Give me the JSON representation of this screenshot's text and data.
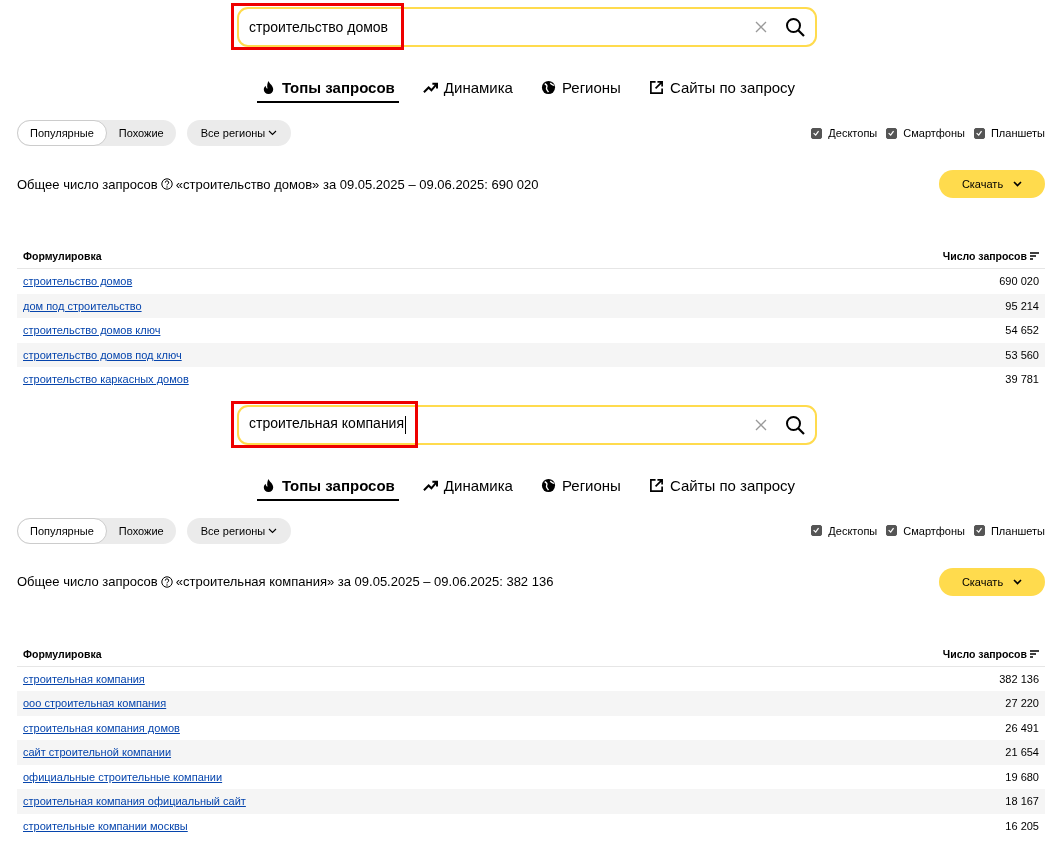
{
  "panels": [
    {
      "search": {
        "value": "строительство домов",
        "highlighted": true,
        "focused": false
      },
      "tabs": [
        {
          "label": "Топы запросов",
          "kind": "fire",
          "selected": true
        },
        {
          "label": "Динамика",
          "kind": "trend",
          "selected": false
        },
        {
          "label": "Регионы",
          "kind": "globe",
          "selected": false
        },
        {
          "label": "Сайты по запросу",
          "kind": "external",
          "selected": false
        }
      ],
      "modes": [
        {
          "label": "Популярные",
          "selected": true
        },
        {
          "label": "Похожие",
          "selected": false
        }
      ],
      "region_button": "Все регионы",
      "devices": [
        {
          "label": "Десктопы",
          "checked": true
        },
        {
          "label": "Смартфоны",
          "checked": true
        },
        {
          "label": "Планшеты",
          "checked": true
        }
      ],
      "total": {
        "label": "Общее число запросов",
        "text": "«строительство домов» за 09.05.2025 – 09.06.2025: 690 020"
      },
      "download_button": "Скачать",
      "table": {
        "columns": [
          "Формулировка",
          "Число запросов"
        ],
        "rows": [
          {
            "phrase": "строительство домов",
            "count": "690 020"
          },
          {
            "phrase": "дом под строительство",
            "count": "95 214"
          },
          {
            "phrase": "строительство домов ключ",
            "count": "54 652"
          },
          {
            "phrase": "строительство домов под ключ",
            "count": "53 560"
          },
          {
            "phrase": "строительство каркасных домов",
            "count": "39 781"
          }
        ]
      }
    },
    {
      "search": {
        "value": "строительная компания",
        "highlighted": true,
        "focused": true
      },
      "tabs": [
        {
          "label": "Топы запросов",
          "kind": "fire",
          "selected": true
        },
        {
          "label": "Динамика",
          "kind": "trend",
          "selected": false
        },
        {
          "label": "Регионы",
          "kind": "globe",
          "selected": false
        },
        {
          "label": "Сайты по запросу",
          "kind": "external",
          "selected": false
        }
      ],
      "modes": [
        {
          "label": "Популярные",
          "selected": true
        },
        {
          "label": "Похожие",
          "selected": false
        }
      ],
      "region_button": "Все регионы",
      "devices": [
        {
          "label": "Десктопы",
          "checked": true
        },
        {
          "label": "Смартфоны",
          "checked": true
        },
        {
          "label": "Планшеты",
          "checked": true
        }
      ],
      "total": {
        "label": "Общее число запросов",
        "text": "«строительная компания» за 09.05.2025 – 09.06.2025: 382 136"
      },
      "download_button": "Скачать",
      "table": {
        "columns": [
          "Формулировка",
          "Число запросов"
        ],
        "rows": [
          {
            "phrase": "строительная компания",
            "count": "382 136"
          },
          {
            "phrase": "ооо строительная компания",
            "count": "27 220"
          },
          {
            "phrase": "строительная компания домов",
            "count": "26 491"
          },
          {
            "phrase": "сайт строительной компании",
            "count": "21 654"
          },
          {
            "phrase": "официальные строительные компании",
            "count": "19 680"
          },
          {
            "phrase": "строительная компания официальный сайт",
            "count": "18 167"
          },
          {
            "phrase": "строительные компании москвы",
            "count": "16 205"
          }
        ]
      }
    }
  ]
}
